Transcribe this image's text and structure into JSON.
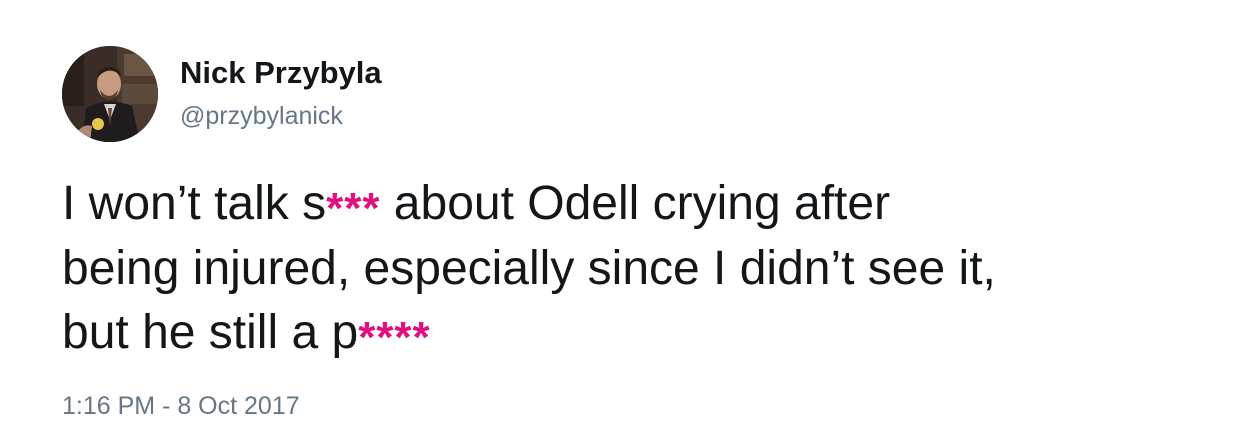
{
  "author": {
    "name": "Nick Przybyla",
    "handle": "@przybylanick",
    "avatar_alt": "profile-photo"
  },
  "tweet": {
    "line1_pre": "I won’t talk s",
    "censor1": "***",
    "line1_post": " about Odell crying after",
    "line2": "being injured, especially since I didn’t see it,",
    "line3_pre": "but he still a p",
    "censor2": "****",
    "censor_color": "#e0107f"
  },
  "meta": {
    "timestamp": "1:16 PM - 8 Oct 2017"
  },
  "colors": {
    "text": "#14171a",
    "secondary": "#657786",
    "background": "#ffffff"
  }
}
